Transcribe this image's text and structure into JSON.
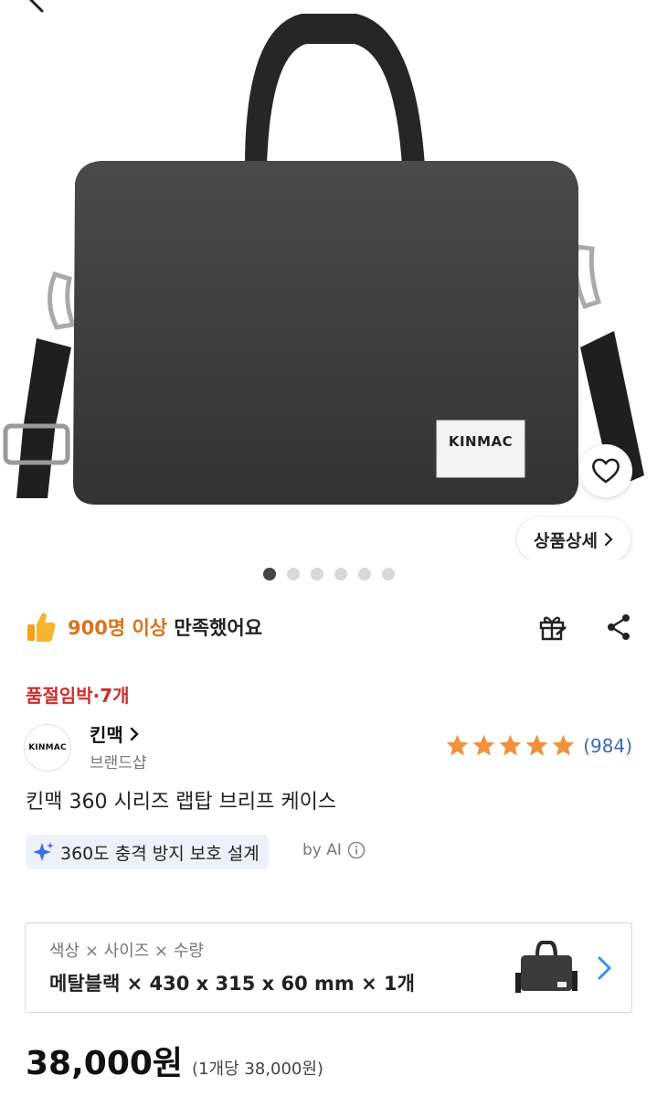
{
  "hero": {
    "brand_label": "KINMAC",
    "detail_button": "상품상세",
    "image_count": 6,
    "active_image_index": 0
  },
  "satisfaction": {
    "icon": "thumbs-up-icon",
    "count_text": "900명 이상",
    "suffix_text": "만족했어요"
  },
  "stock_alert": "품절임박·7개",
  "brand": {
    "logo_text": "KINMAC",
    "name": "킨맥",
    "subtitle": "브랜드샵"
  },
  "rating": {
    "stars": 5,
    "count_text": "(984)"
  },
  "product_title": "킨맥 360 시리즈 랩탑 브리프 케이스",
  "ai_summary": {
    "text": "360도 충격 방지 보호 설계",
    "by_label": "by AI"
  },
  "option": {
    "label": "색상 × 사이즈 × 수량",
    "value": "메탈블랙 × 430 x 315 x 60 mm × 1개"
  },
  "price": {
    "total": "38,000원",
    "unit": "(1개당 38,000원)"
  },
  "colors": {
    "accent_orange": "#d9731a",
    "alert_red": "#c9302c",
    "rating_star": "#f2913d",
    "link_blue": "#3b6ab7"
  }
}
